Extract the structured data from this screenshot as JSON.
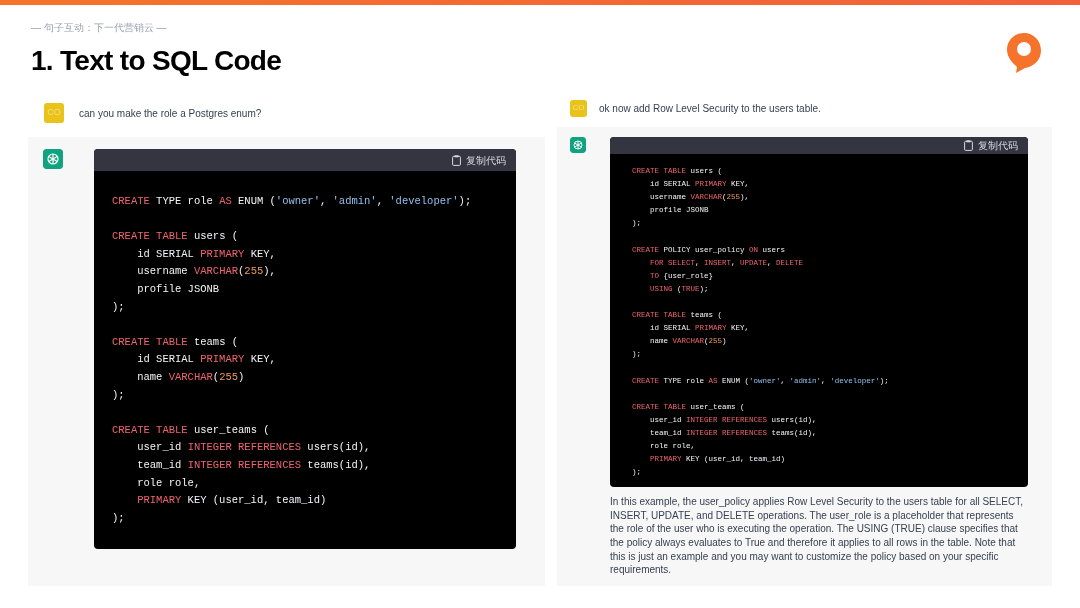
{
  "header": {
    "subtitle": "— 句子互动：下一代营销云 —",
    "title": "1. Text to SQL Code"
  },
  "chats": [
    {
      "user": {
        "avatar_text": "CO",
        "message": "can you make the role a Postgres enum?"
      },
      "assistant": {
        "copy_label": "复制代码",
        "code": [
          {
            "kind": "code",
            "indented": false,
            "tokens": [
              {
                "kind": "keyword",
                "text": "CREATE"
              },
              {
                "kind": "plain",
                "text": " TYPE role "
              },
              {
                "kind": "keyword",
                "text": "AS"
              },
              {
                "kind": "plain",
                "text": " ENUM ("
              },
              {
                "kind": "string",
                "text": "'owner'"
              },
              {
                "kind": "plain",
                "text": ", "
              },
              {
                "kind": "string",
                "text": "'admin'"
              },
              {
                "kind": "plain",
                "text": ", "
              },
              {
                "kind": "string",
                "text": "'developer'"
              },
              {
                "kind": "plain",
                "text": ");"
              }
            ]
          },
          {
            "kind": "blank"
          },
          {
            "kind": "code",
            "indented": false,
            "tokens": [
              {
                "kind": "keyword",
                "text": "CREATE TABLE"
              },
              {
                "kind": "plain",
                "text": " users ("
              }
            ]
          },
          {
            "kind": "code",
            "indented": true,
            "tokens": [
              {
                "kind": "plain",
                "text": "id SERIAL "
              },
              {
                "kind": "keyword",
                "text": "PRIMARY"
              },
              {
                "kind": "plain",
                "text": " KEY,"
              }
            ]
          },
          {
            "kind": "code",
            "indented": true,
            "tokens": [
              {
                "kind": "plain",
                "text": "username "
              },
              {
                "kind": "keyword",
                "text": "VARCHAR"
              },
              {
                "kind": "plain",
                "text": "("
              },
              {
                "kind": "number",
                "text": "255"
              },
              {
                "kind": "plain",
                "text": "),"
              }
            ]
          },
          {
            "kind": "code",
            "indented": true,
            "tokens": [
              {
                "kind": "plain",
                "text": "profile JSONB"
              }
            ]
          },
          {
            "kind": "code",
            "indented": false,
            "tokens": [
              {
                "kind": "plain",
                "text": ");"
              }
            ]
          },
          {
            "kind": "blank"
          },
          {
            "kind": "code",
            "indented": false,
            "tokens": [
              {
                "kind": "keyword",
                "text": "CREATE TABLE"
              },
              {
                "kind": "plain",
                "text": " teams ("
              }
            ]
          },
          {
            "kind": "code",
            "indented": true,
            "tokens": [
              {
                "kind": "plain",
                "text": "id SERIAL "
              },
              {
                "kind": "keyword",
                "text": "PRIMARY"
              },
              {
                "kind": "plain",
                "text": " KEY,"
              }
            ]
          },
          {
            "kind": "code",
            "indented": true,
            "tokens": [
              {
                "kind": "plain",
                "text": "name "
              },
              {
                "kind": "keyword",
                "text": "VARCHAR"
              },
              {
                "kind": "plain",
                "text": "("
              },
              {
                "kind": "number",
                "text": "255"
              },
              {
                "kind": "plain",
                "text": ")"
              }
            ]
          },
          {
            "kind": "code",
            "indented": false,
            "tokens": [
              {
                "kind": "plain",
                "text": ");"
              }
            ]
          },
          {
            "kind": "blank"
          },
          {
            "kind": "code",
            "indented": false,
            "tokens": [
              {
                "kind": "keyword",
                "text": "CREATE TABLE"
              },
              {
                "kind": "plain",
                "text": " user_teams ("
              }
            ]
          },
          {
            "kind": "code",
            "indented": true,
            "tokens": [
              {
                "kind": "plain",
                "text": "user_id "
              },
              {
                "kind": "keyword",
                "text": "INTEGER REFERENCES"
              },
              {
                "kind": "plain",
                "text": " users(id),"
              }
            ]
          },
          {
            "kind": "code",
            "indented": true,
            "tokens": [
              {
                "kind": "plain",
                "text": "team_id "
              },
              {
                "kind": "keyword",
                "text": "INTEGER REFERENCES"
              },
              {
                "kind": "plain",
                "text": " teams(id),"
              }
            ]
          },
          {
            "kind": "code",
            "indented": true,
            "tokens": [
              {
                "kind": "plain",
                "text": "role role,"
              }
            ]
          },
          {
            "kind": "code",
            "indented": true,
            "tokens": [
              {
                "kind": "keyword",
                "text": "PRIMARY"
              },
              {
                "kind": "plain",
                "text": " KEY (user_id, team_id)"
              }
            ]
          },
          {
            "kind": "code",
            "indented": false,
            "tokens": [
              {
                "kind": "plain",
                "text": ");"
              }
            ]
          }
        ]
      }
    },
    {
      "user": {
        "avatar_text": "CO",
        "message": "ok now add Row Level Security to the users table."
      },
      "assistant": {
        "copy_label": "复制代码",
        "code": [
          {
            "kind": "code",
            "indented": false,
            "tokens": [
              {
                "kind": "keyword",
                "text": "CREATE TABLE"
              },
              {
                "kind": "plain",
                "text": " users ("
              }
            ]
          },
          {
            "kind": "code",
            "indented": true,
            "tokens": [
              {
                "kind": "plain",
                "text": "id SERIAL "
              },
              {
                "kind": "keyword",
                "text": "PRIMARY"
              },
              {
                "kind": "plain",
                "text": " KEY,"
              }
            ]
          },
          {
            "kind": "code",
            "indented": true,
            "tokens": [
              {
                "kind": "plain",
                "text": "username "
              },
              {
                "kind": "keyword",
                "text": "VARCHAR"
              },
              {
                "kind": "plain",
                "text": "("
              },
              {
                "kind": "number",
                "text": "255"
              },
              {
                "kind": "plain",
                "text": "),"
              }
            ]
          },
          {
            "kind": "code",
            "indented": true,
            "tokens": [
              {
                "kind": "plain",
                "text": "profile JSONB"
              }
            ]
          },
          {
            "kind": "code",
            "indented": false,
            "tokens": [
              {
                "kind": "plain",
                "text": ");"
              }
            ]
          },
          {
            "kind": "blank"
          },
          {
            "kind": "code",
            "indented": false,
            "tokens": [
              {
                "kind": "keyword",
                "text": "CREATE"
              },
              {
                "kind": "plain",
                "text": " POLICY user_policy "
              },
              {
                "kind": "keyword",
                "text": "ON"
              },
              {
                "kind": "plain",
                "text": " users"
              }
            ]
          },
          {
            "kind": "code",
            "indented": true,
            "tokens": [
              {
                "kind": "keyword",
                "text": "FOR SELECT"
              },
              {
                "kind": "plain",
                "text": ", "
              },
              {
                "kind": "keyword",
                "text": "INSERT"
              },
              {
                "kind": "plain",
                "text": ", "
              },
              {
                "kind": "keyword",
                "text": "UPDATE"
              },
              {
                "kind": "plain",
                "text": ", "
              },
              {
                "kind": "keyword",
                "text": "DELETE"
              }
            ]
          },
          {
            "kind": "code",
            "indented": true,
            "tokens": [
              {
                "kind": "keyword",
                "text": "TO"
              },
              {
                "kind": "plain",
                "text": " {user_role}"
              }
            ]
          },
          {
            "kind": "code",
            "indented": true,
            "tokens": [
              {
                "kind": "keyword",
                "text": "USING"
              },
              {
                "kind": "plain",
                "text": " ("
              },
              {
                "kind": "keyword",
                "text": "TRUE"
              },
              {
                "kind": "plain",
                "text": ");"
              }
            ]
          },
          {
            "kind": "blank"
          },
          {
            "kind": "code",
            "indented": false,
            "tokens": [
              {
                "kind": "keyword",
                "text": "CREATE TABLE"
              },
              {
                "kind": "plain",
                "text": " teams ("
              }
            ]
          },
          {
            "kind": "code",
            "indented": true,
            "tokens": [
              {
                "kind": "plain",
                "text": "id SERIAL "
              },
              {
                "kind": "keyword",
                "text": "PRIMARY"
              },
              {
                "kind": "plain",
                "text": " KEY,"
              }
            ]
          },
          {
            "kind": "code",
            "indented": true,
            "tokens": [
              {
                "kind": "plain",
                "text": "name "
              },
              {
                "kind": "keyword",
                "text": "VARCHAR"
              },
              {
                "kind": "plain",
                "text": "("
              },
              {
                "kind": "number",
                "text": "255"
              },
              {
                "kind": "plain",
                "text": ")"
              }
            ]
          },
          {
            "kind": "code",
            "indented": false,
            "tokens": [
              {
                "kind": "plain",
                "text": ");"
              }
            ]
          },
          {
            "kind": "blank"
          },
          {
            "kind": "code",
            "indented": false,
            "tokens": [
              {
                "kind": "keyword",
                "text": "CREATE"
              },
              {
                "kind": "plain",
                "text": " TYPE role "
              },
              {
                "kind": "keyword",
                "text": "AS"
              },
              {
                "kind": "plain",
                "text": " ENUM ("
              },
              {
                "kind": "string",
                "text": "'owner'"
              },
              {
                "kind": "plain",
                "text": ", "
              },
              {
                "kind": "string",
                "text": "'admin'"
              },
              {
                "kind": "plain",
                "text": ", "
              },
              {
                "kind": "string",
                "text": "'developer'"
              },
              {
                "kind": "plain",
                "text": ");"
              }
            ]
          },
          {
            "kind": "blank"
          },
          {
            "kind": "code",
            "indented": false,
            "tokens": [
              {
                "kind": "keyword",
                "text": "CREATE TABLE"
              },
              {
                "kind": "plain",
                "text": " user_teams ("
              }
            ]
          },
          {
            "kind": "code",
            "indented": true,
            "tokens": [
              {
                "kind": "plain",
                "text": "user_id "
              },
              {
                "kind": "keyword",
                "text": "INTEGER REFERENCES"
              },
              {
                "kind": "plain",
                "text": " users(id),"
              }
            ]
          },
          {
            "kind": "code",
            "indented": true,
            "tokens": [
              {
                "kind": "plain",
                "text": "team_id "
              },
              {
                "kind": "keyword",
                "text": "INTEGER REFERENCES"
              },
              {
                "kind": "plain",
                "text": " teams(id),"
              }
            ]
          },
          {
            "kind": "code",
            "indented": true,
            "tokens": [
              {
                "kind": "plain",
                "text": "role role,"
              }
            ]
          },
          {
            "kind": "code",
            "indented": true,
            "tokens": [
              {
                "kind": "keyword",
                "text": "PRIMARY"
              },
              {
                "kind": "plain",
                "text": " KEY (user_id, team_id)"
              }
            ]
          },
          {
            "kind": "code",
            "indented": false,
            "tokens": [
              {
                "kind": "plain",
                "text": ");"
              }
            ]
          }
        ],
        "explanation": "In this example, the user_policy applies Row Level Security to the users table for all SELECT, INSERT, UPDATE, and DELETE operations. The user_role is a placeholder that represents the role of the user who is executing the operation. The USING (TRUE) clause specifies that the policy always evaluates to True and therefore it applies to all rows in the table. Note that this is just an example and you may want to customize the policy based on your specific requirements."
      }
    }
  ]
}
